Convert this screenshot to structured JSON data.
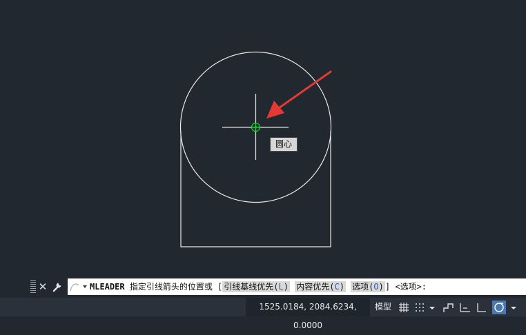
{
  "tooltip": {
    "text": "圆心"
  },
  "command_line": {
    "command": "MLEADER",
    "prompt": "指定引线箭头的位置或",
    "bracket_open": "[",
    "bracket_close": "]",
    "options": [
      {
        "label": "引线基线优先(",
        "key": "L",
        "close": ")"
      },
      {
        "label": "内容优先(",
        "key": "C",
        "close": ")"
      },
      {
        "label": "选项(",
        "key": "O",
        "close": ")"
      }
    ],
    "default_option": "<选项>:"
  },
  "status_bar": {
    "coordinates": "1525.0184, 2084.6234, 0.0000",
    "model_tab": "模型"
  },
  "icons": [
    "close-icon",
    "wrench-icon",
    "recent-commands-icon",
    "grid-icon",
    "snap-icon",
    "ortho-icon",
    "polar-icon",
    "osnap-icon"
  ],
  "colors": {
    "background": "#212830",
    "geometry": "#e8e8e8",
    "arrow": "#e53935",
    "snap_marker": "#2ecc40",
    "command_input": "#ffffff",
    "option_key": "#1b5fb4"
  }
}
